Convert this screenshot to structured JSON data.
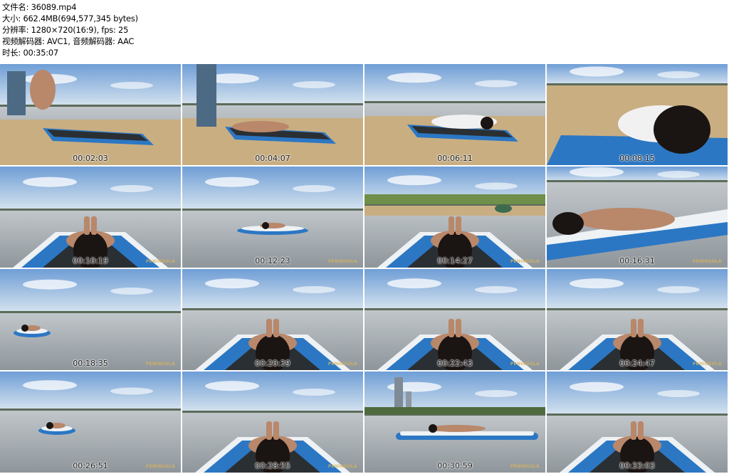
{
  "info": {
    "file_name": "文件名: 36089.mp4",
    "size": "大小: 662.4MB(694,577,345 bytes)",
    "resolution": "分辨率: 1280×720(16:9), fps: 25",
    "codec": "视频解码器: AVC1, 音频解码器: AAC",
    "duration": "时长: 00:35:07"
  },
  "watermark": "PENINSULA",
  "thumbnails": [
    {
      "time": "00:02:03",
      "scene": "shore-standing",
      "wm": false
    },
    {
      "time": "00:04:07",
      "scene": "shore-lying",
      "wm": false
    },
    {
      "time": "00:06:11",
      "scene": "shore-board-angled",
      "wm": false
    },
    {
      "time": "00:08:15",
      "scene": "closeup-board",
      "wm": false
    },
    {
      "time": "00:10:19",
      "scene": "rear-view-far",
      "wm": true
    },
    {
      "time": "00:12:23",
      "scene": "far-board",
      "wm": true
    },
    {
      "time": "00:14:27",
      "scene": "rear-view-beach",
      "wm": true
    },
    {
      "time": "00:16:31",
      "scene": "side-closeup",
      "wm": true
    },
    {
      "time": "00:18:35",
      "scene": "small-board",
      "wm": true
    },
    {
      "time": "00:20:39",
      "scene": "rear-view-near",
      "wm": true
    },
    {
      "time": "00:22:43",
      "scene": "rear-view-near",
      "wm": true
    },
    {
      "time": "00:24:47",
      "scene": "rear-view-near",
      "wm": true
    },
    {
      "time": "00:26:51",
      "scene": "small-board-left",
      "wm": true
    },
    {
      "time": "00:28:55",
      "scene": "rear-view-near",
      "wm": true
    },
    {
      "time": "00:30:59",
      "scene": "towers-board",
      "wm": true
    },
    {
      "time": "00:33:03",
      "scene": "rear-view-shore",
      "wm": false
    }
  ],
  "colors": {
    "sky_top": "#6f9ed6",
    "sky_bottom": "#d7e4ef",
    "water": "#a9afb3",
    "sand": "#c9ae82",
    "board_blue": "#2b77c4",
    "board_white": "#eef2f5",
    "hair": "#1a1412",
    "skin": "#b9876a",
    "timestamp": "#1b1b1b",
    "watermark": "#d8b35a"
  }
}
